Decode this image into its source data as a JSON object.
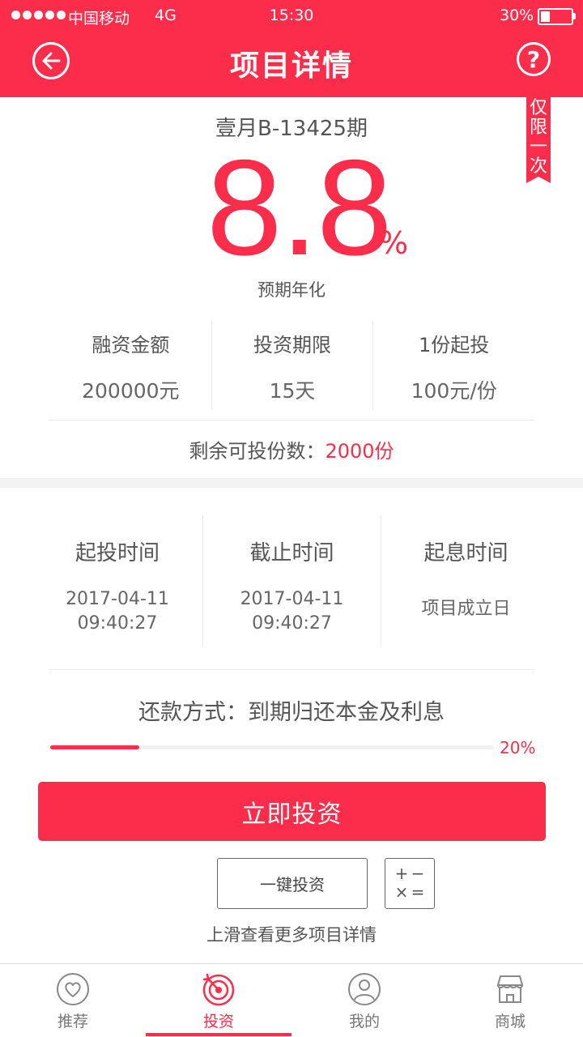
{
  "status_bar": {
    "carrier": "中国移动",
    "network": "4G",
    "time": "15:30",
    "battery": "30%",
    "battery_level": 0.3
  },
  "header": {
    "title": "项目详情",
    "back_icon": "back-arrow-icon",
    "help_icon": "question-icon"
  },
  "ribbon": "仅限一次",
  "product": {
    "period_name": "壹月B-13425期",
    "rate": "8.8",
    "rate_unit": "%",
    "rate_label": "预期年化"
  },
  "stats": [
    {
      "label": "融资金额",
      "value": "200000元"
    },
    {
      "label": "投资期限",
      "value": "15天"
    },
    {
      "label": "1份起投",
      "value": "100元/份"
    }
  ],
  "remaining": {
    "label": "剩余可投份数：",
    "value": "2000份"
  },
  "times": [
    {
      "label": "起投时间",
      "date": "2017-04-11",
      "time": "09:40:27"
    },
    {
      "label": "截止时间",
      "date": "2017-04-11",
      "time": "09:40:27"
    },
    {
      "label": "起息时间",
      "date": "项目成立日",
      "time": ""
    }
  ],
  "repayment": "还款方式：到期归还本金及利息",
  "progress": {
    "percent": 20,
    "label": "20%"
  },
  "actions": {
    "invest_now": "立即投资",
    "one_click": "一键投资",
    "calculator_icon": "calculator-icon",
    "calc_symbols": [
      "+",
      "−",
      "×",
      "="
    ]
  },
  "more_hint": "上滑查看更多项目详情",
  "tabs": [
    {
      "label": "推荐",
      "icon": "heart-icon",
      "active": false
    },
    {
      "label": "投资",
      "icon": "target-icon",
      "active": true
    },
    {
      "label": "我的",
      "icon": "user-icon",
      "active": false
    },
    {
      "label": "商城",
      "icon": "store-icon",
      "active": false
    }
  ],
  "colors": {
    "accent": "#fb2d4a",
    "section_gap": "#f2f3f5"
  }
}
